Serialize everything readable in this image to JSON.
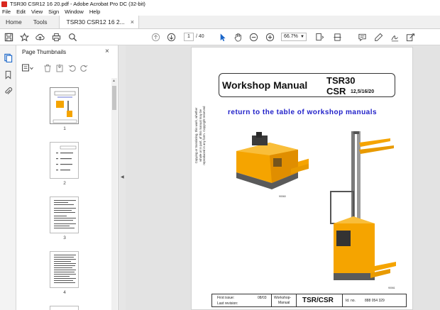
{
  "window": {
    "title": "TSR30 CSR12 16 20.pdf - Adobe Acrobat Pro DC (32-bit)"
  },
  "menu": [
    "File",
    "Edit",
    "View",
    "Sign",
    "Window",
    "Help"
  ],
  "tabs": {
    "home": "Home",
    "tools": "Tools",
    "document": "TSR30 CSR12 16 2...",
    "close": "×"
  },
  "toolbar": {
    "current_page": "1",
    "total_pages": "/ 40",
    "zoom": "66.7%"
  },
  "thumbnails_panel": {
    "title": "Page Thumbnails",
    "close": "×",
    "pages": [
      "1",
      "2",
      "3",
      "4"
    ]
  },
  "document": {
    "heading": "Workshop Manual",
    "model_line1": "TSR30",
    "model_line2": "CSR",
    "model_sizes": "12,5/16/20",
    "link": "return to the table of workshop manuals",
    "copyright": "Copying or translating, this work, whether whole or in part, of this manual may be reproduced in any form. Copyright reserved",
    "image1_code": "90060",
    "image2_code": "90061",
    "footer": {
      "first_issue_label": "First issue:",
      "first_issue_value": "08/03",
      "last_revision_label": "Last revision:",
      "manual_type_line1": "Workshop-",
      "manual_type_line2": "Manual",
      "model": "TSR/CSR",
      "id_label": "Id. no.",
      "id_value": "888 054 329"
    }
  },
  "colors": {
    "acrobat_red": "#d9271e",
    "link_blue": "#1f1fc9",
    "truck_orange": "#f5a400",
    "truck_gray": "#5a5a5a"
  }
}
